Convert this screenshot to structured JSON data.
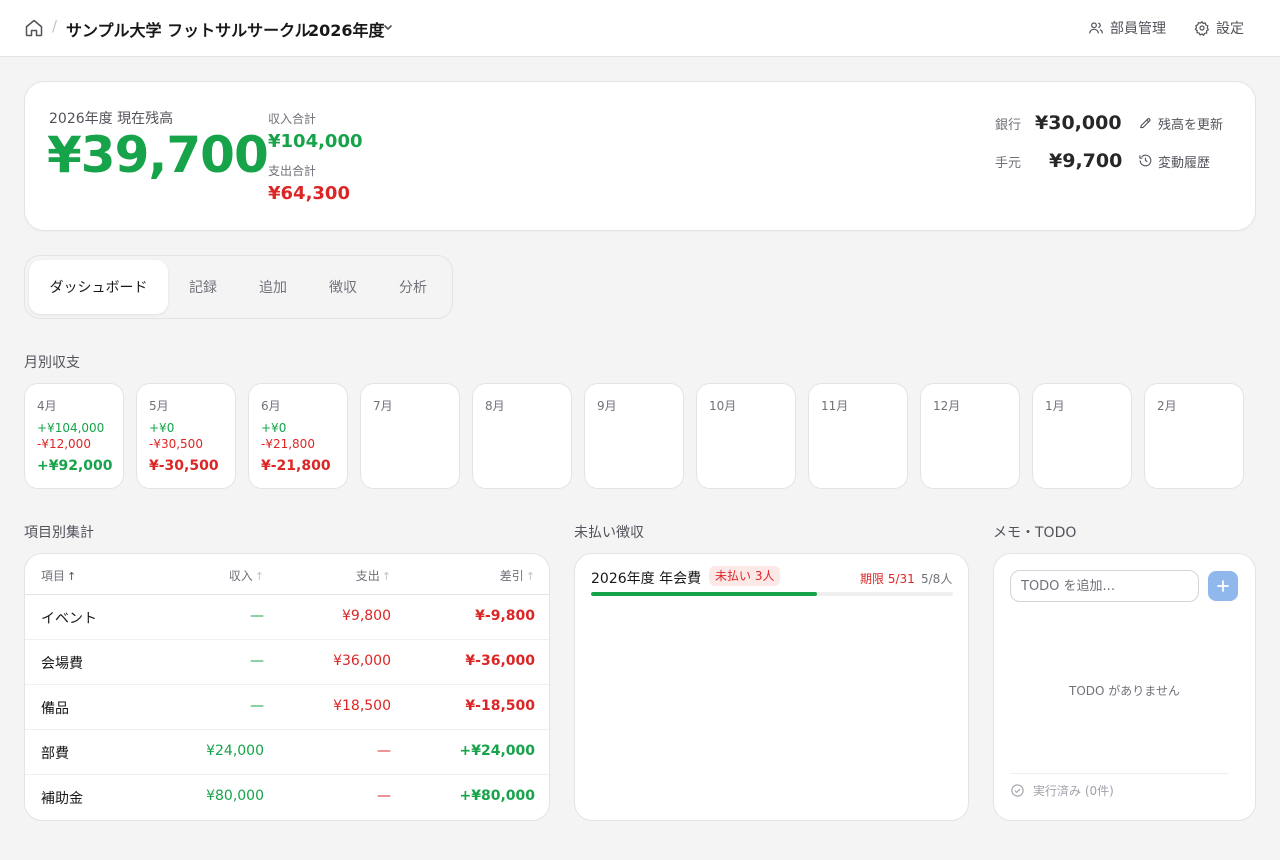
{
  "header": {
    "org_name": "サンプル大学 フットサルサークル",
    "separator": "/",
    "year_label": "2026年度",
    "members_label": "部員管理",
    "settings_label": "設定"
  },
  "balance": {
    "label": "2026年度 現在残高",
    "amount": "¥39,700",
    "income_label": "収入合計",
    "income": "¥104,000",
    "expense_label": "支出合計",
    "expense": "¥64,300",
    "bank_label": "銀行",
    "bank": "¥30,000",
    "cash_label": "手元",
    "cash": "¥9,700",
    "update_label": "残高を更新",
    "history_label": "変動履歴"
  },
  "tabs": [
    {
      "label": "ダッシュボード",
      "active": true
    },
    {
      "label": "記録",
      "active": false
    },
    {
      "label": "追加",
      "active": false
    },
    {
      "label": "徴収",
      "active": false
    },
    {
      "label": "分析",
      "active": false
    }
  ],
  "monthly": {
    "title": "月別収支",
    "months": [
      {
        "name": "4月",
        "income": "+¥104,000",
        "expense": "-¥12,000",
        "net": "+¥92,000",
        "net_positive": true
      },
      {
        "name": "5月",
        "income": "+¥0",
        "expense": "-¥30,500",
        "net": "¥-30,500",
        "net_positive": false
      },
      {
        "name": "6月",
        "income": "+¥0",
        "expense": "-¥21,800",
        "net": "¥-21,800",
        "net_positive": false
      },
      {
        "name": "7月"
      },
      {
        "name": "8月"
      },
      {
        "name": "9月"
      },
      {
        "name": "10月"
      },
      {
        "name": "11月"
      },
      {
        "name": "12月"
      },
      {
        "name": "1月"
      },
      {
        "name": "2月"
      }
    ]
  },
  "categories": {
    "title": "項目別集計",
    "columns": {
      "item": "項目",
      "income": "収入",
      "expense": "支出",
      "diff": "差引"
    },
    "sort_arrow": "↑",
    "rows": [
      {
        "name": "イベント",
        "income": "—",
        "expense": "¥9,800",
        "diff": "¥-9,800",
        "diff_positive": false
      },
      {
        "name": "会場費",
        "income": "—",
        "expense": "¥36,000",
        "diff": "¥-36,000",
        "diff_positive": false
      },
      {
        "name": "備品",
        "income": "—",
        "expense": "¥18,500",
        "diff": "¥-18,500",
        "diff_positive": false
      },
      {
        "name": "部費",
        "income": "¥24,000",
        "expense": "—",
        "diff": "+¥24,000",
        "diff_positive": true
      },
      {
        "name": "補助金",
        "income": "¥80,000",
        "expense": "—",
        "diff": "+¥80,000",
        "diff_positive": true
      }
    ]
  },
  "unpaid": {
    "title": "未払い徴収",
    "items": [
      {
        "name": "2026年度 年会費",
        "badge": "未払い 3人",
        "due": "期限 5/31",
        "count": "5/8人",
        "progress": 0.625
      }
    ]
  },
  "todo": {
    "title": "メモ・TODO",
    "placeholder": "TODO を追加...",
    "add_label": "+",
    "empty": "TODO がありません",
    "done_label": "実行済み (0件)"
  },
  "colors": {
    "positive": "#16a34a",
    "negative": "#dc2626",
    "accent_button": "#90b8ec",
    "badge_bg": "#fde8e8"
  }
}
